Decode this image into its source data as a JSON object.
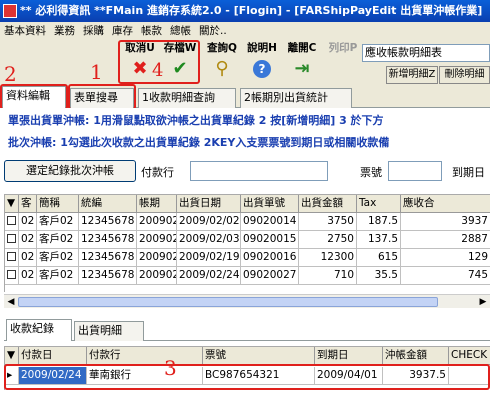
{
  "window": {
    "title": "** 必利得資訊 **FMain  進銷存系統2.0 - [Flogin] - [FARShipPayEdit 出貨單沖帳作業]"
  },
  "menu": [
    "基本資料",
    "業務",
    "採購",
    "庫存",
    "帳款",
    "總帳",
    "關於.."
  ],
  "toolbar": {
    "cancel": "取消U",
    "save": "存檔W",
    "query": "查詢Q",
    "help": "說明H",
    "exit": "離開C",
    "print": "列印P",
    "report_select": "應收帳款明細表",
    "add_detail": "新增明細Z",
    "delete_detail": "刪除明細"
  },
  "annotations": {
    "n1": "1",
    "n2": "2",
    "n3": "3",
    "n4": "4"
  },
  "colors": {
    "annotation": "#e0201c",
    "info_text": "#1a3fb0",
    "title_bar": "#0a4fc8",
    "selection": "#316ac5"
  },
  "tabs": [
    "資料編輯",
    "表單搜尋",
    "1收款明細查詢",
    "2帳期別出貨統計"
  ],
  "info": {
    "line1": "單張出貨單沖帳: 1用滑鼠點取欲沖帳之出貨單紀錄  2 按[新增明細]  3 於下方",
    "line2": "批次沖帳: 1勾選此次收款之出貨單紀錄  2KEY入支票票號到期日或相關收款備"
  },
  "form": {
    "batch_button": "選定紀錄批次沖帳",
    "payer_bank_label": "付款行",
    "check_no_label": "票號",
    "due_date_label": "到期日"
  },
  "upper_grid": {
    "headers": [
      "▼",
      "客",
      "簡稱",
      "統編",
      "帳期",
      "出貨日期",
      "出貨單號",
      "出貨金額",
      "Tax",
      "應收合"
    ],
    "rows": [
      [
        "02",
        "客戶02",
        "12345678",
        "200902",
        "2009/02/02",
        "09020014",
        "3750",
        "187.5",
        "3937"
      ],
      [
        "02",
        "客戶02",
        "12345678",
        "200902",
        "2009/02/03",
        "09020015",
        "2750",
        "137.5",
        "2887"
      ],
      [
        "02",
        "客戶02",
        "12345678",
        "200902",
        "2009/02/19",
        "09020016",
        "12300",
        "615",
        "129"
      ],
      [
        "02",
        "客戶02",
        "12345678",
        "200902",
        "2009/02/24",
        "09020027",
        "710",
        "35.5",
        "745"
      ]
    ]
  },
  "scroll": {
    "left": "◀",
    "right": "▶"
  },
  "lower_tabs": [
    "收款紀錄",
    "出貨明細"
  ],
  "lower_grid": {
    "headers": [
      "付款日",
      "付款行",
      "票號",
      "到期日",
      "沖帳金額",
      "CHECK"
    ],
    "row_marker": "▸",
    "rows": [
      [
        "2009/02/24",
        "華南銀行",
        "BC987654321",
        "2009/04/01",
        "3937.5",
        ""
      ]
    ]
  },
  "icons": {
    "app": "app-icon",
    "cancel": "cross-icon",
    "save": "checkmark-icon",
    "query": "magnifier-icon",
    "help": "question-icon",
    "exit": "exit-door-icon"
  }
}
